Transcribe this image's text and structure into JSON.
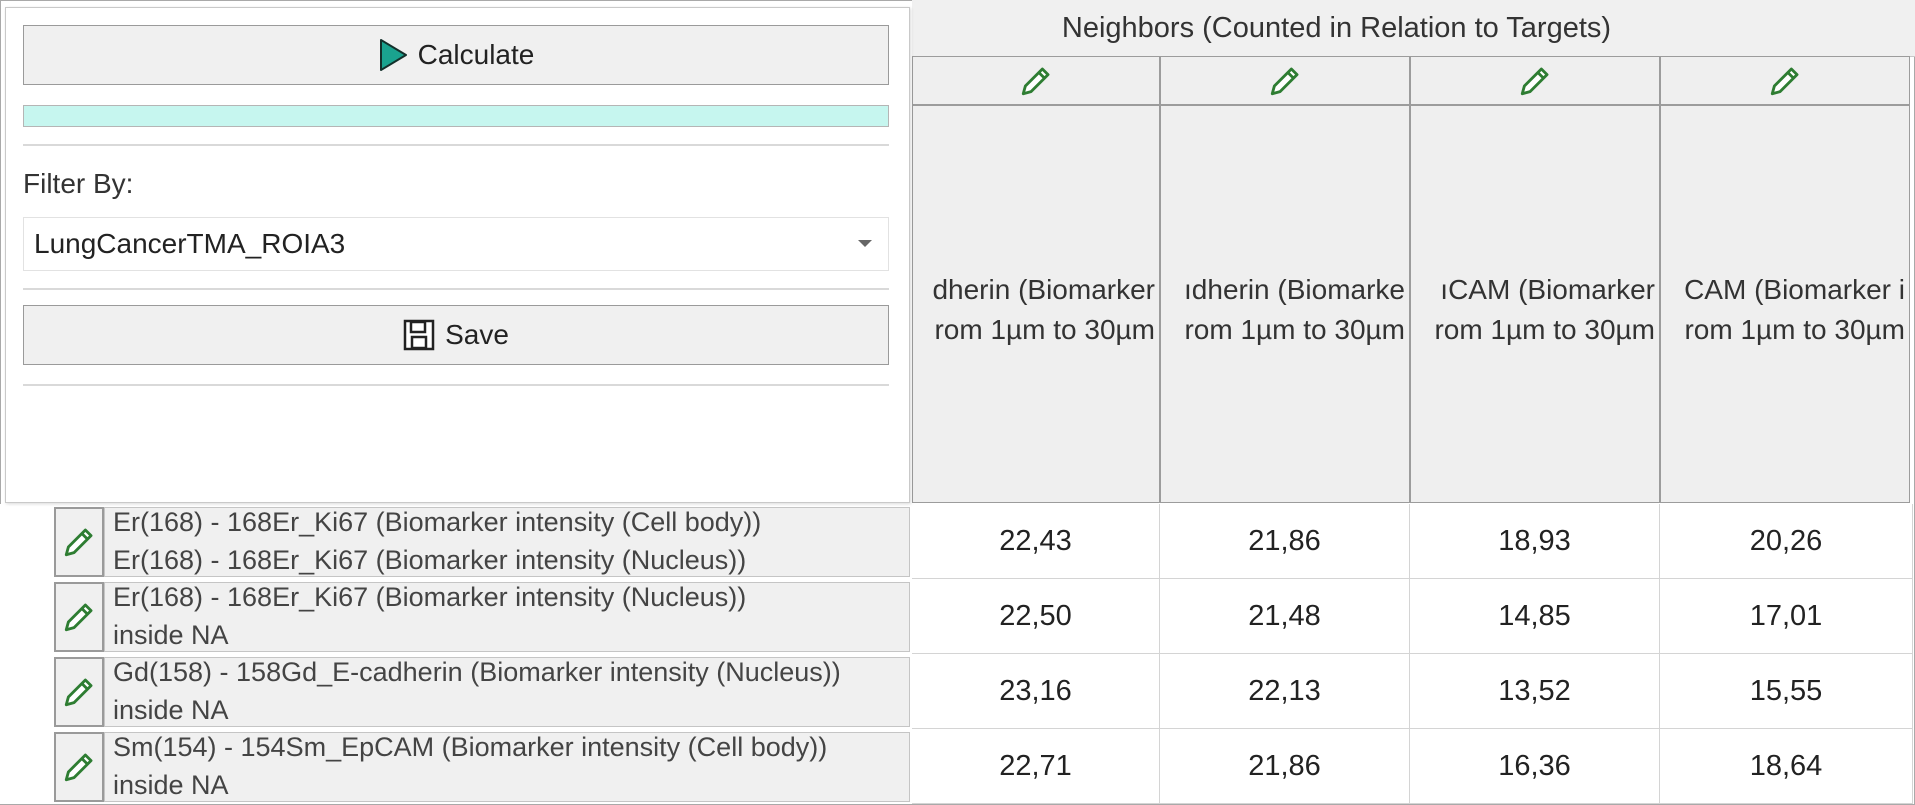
{
  "panel": {
    "calculate_label": "Calculate",
    "progress": 1.0,
    "filter_label": "Filter By:",
    "filter_value": "LungCancerTMA_ROIA3",
    "save_label": "Save"
  },
  "grid": {
    "group_header": "Neighbors (Counted in Relation to Targets)",
    "columns": [
      {
        "line1": "dherin (Biomarker",
        "line2": "rom 1µm to 30µm"
      },
      {
        "line1": "ıdherin (Biomarke",
        "line2": "rom 1µm to 30µm"
      },
      {
        "line1": "ıCAM (Biomarker",
        "line2": "rom 1µm to 30µm"
      },
      {
        "line1": "CAM (Biomarker i",
        "line2": "rom 1µm to 30µm"
      }
    ],
    "rows": [
      {
        "line1": "Er(168) - 168Er_Ki67 (Biomarker intensity (Cell body))",
        "line2": "Er(168) - 168Er_Ki67 (Biomarker intensity (Nucleus))",
        "values": [
          "22,43",
          "21,86",
          "18,93",
          "20,26"
        ]
      },
      {
        "line1": "Er(168) - 168Er_Ki67 (Biomarker intensity (Nucleus))",
        "line2": "inside NA",
        "values": [
          "22,50",
          "21,48",
          "14,85",
          "17,01"
        ]
      },
      {
        "line1": "Gd(158) - 158Gd_E-cadherin (Biomarker intensity (Nucleus))",
        "line2": "inside NA",
        "values": [
          "23,16",
          "22,13",
          "13,52",
          "15,55"
        ]
      },
      {
        "line1": "Sm(154) - 154Sm_EpCAM (Biomarker intensity (Cell body))",
        "line2": "inside NA",
        "values": [
          "22,71",
          "21,86",
          "16,36",
          "18,64"
        ]
      }
    ]
  },
  "colors": {
    "accent_teal": "#1aa38f",
    "progress_fill": "#c6f6ef",
    "pencil_green": "#2e7d32"
  },
  "icons": {
    "calculate": "play-icon",
    "save": "floppy-disk-icon",
    "edit": "pencil-icon",
    "dropdown": "caret-down-icon"
  }
}
